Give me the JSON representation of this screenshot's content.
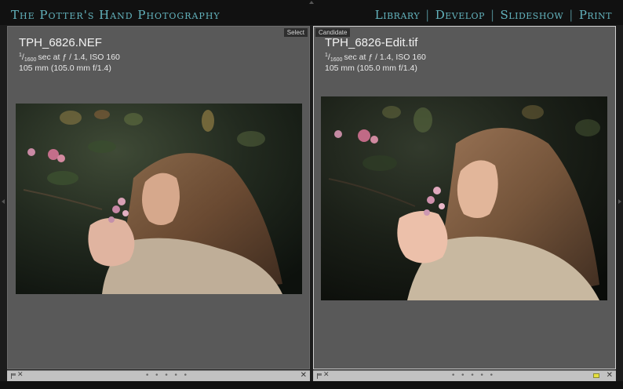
{
  "header": {
    "brand": "The Potter's Hand Photography",
    "modules": [
      "Library",
      "Develop",
      "Slideshow",
      "Print"
    ]
  },
  "left_pane": {
    "tag": "Select",
    "filename": "TPH_6826.NEF",
    "shutter_num": "1",
    "shutter_den": "1600",
    "exposure": "sec at ƒ / 1.4, ISO 160",
    "lens": "105 mm (105.0 mm f/1.4)"
  },
  "right_pane": {
    "tag": "Candidate",
    "filename": "TPH_6826-Edit.tif",
    "shutter_num": "1",
    "shutter_den": "1600",
    "exposure": "sec at ƒ / 1.4, ISO 160",
    "lens": "105 mm (105.0 mm f/1.4)"
  },
  "bottom": {
    "dots": "• • • • •",
    "close": "✕"
  },
  "colors": {
    "module_text": "#63b3bd",
    "pane_bg": "#595959",
    "active_border": "#d0d0d0",
    "app_bg": "#1c1c1c"
  }
}
